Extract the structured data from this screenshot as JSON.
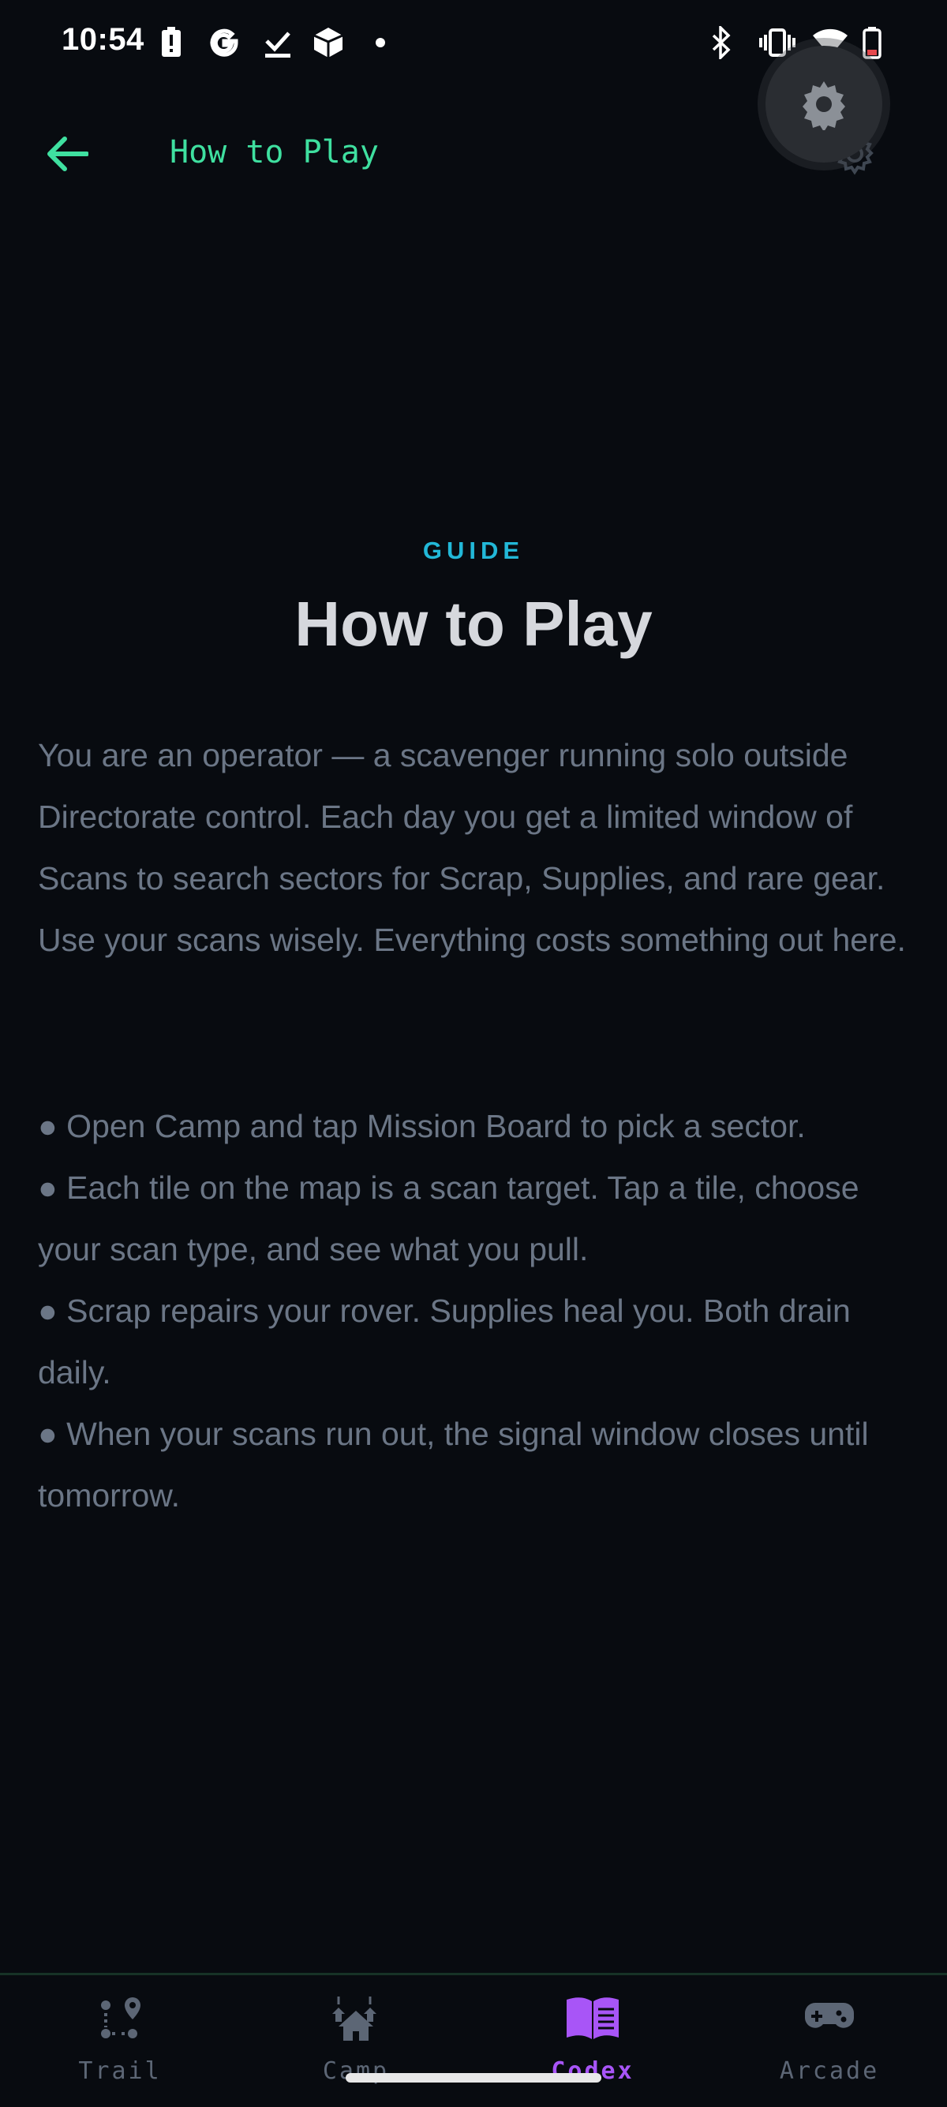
{
  "status_bar": {
    "time": "10:54",
    "icons": [
      "battery-alert-icon",
      "google-icon",
      "download-done-icon",
      "cube-icon",
      "dot-icon",
      "bluetooth-icon",
      "vibrate-icon",
      "wifi-icon",
      "battery-icon"
    ]
  },
  "app_bar": {
    "title": "How to Play",
    "back_icon": "arrow-left-icon",
    "settings_icon": "gear-icon"
  },
  "content": {
    "eyebrow": "GUIDE",
    "title": "How to Play",
    "intro": "You are an operator — a scavenger running solo outside Directorate control. Each day you get a limited window of Scans to search sectors for Scrap, Supplies, and rare gear. Use your scans wisely. Everything costs something out here.",
    "bullet_marker": "●",
    "bullets": [
      "Open Camp and tap Mission Board to pick a sector.",
      "Each tile on the map is a scan target. Tap a tile, choose your scan type, and see what you pull.",
      "Scrap repairs your rover. Supplies heal you. Both drain daily.",
      "When your scans run out, the signal window closes until tomorrow."
    ]
  },
  "bottom_nav": {
    "items": [
      {
        "label": "Trail",
        "icon": "trail-route-icon",
        "active": false
      },
      {
        "label": "Camp",
        "icon": "camp-houses-icon",
        "active": false
      },
      {
        "label": "Codex",
        "icon": "codex-book-icon",
        "active": true
      },
      {
        "label": "Arcade",
        "icon": "gamepad-icon",
        "active": false
      }
    ]
  },
  "colors": {
    "background": "#080b10",
    "accent_green": "#3fe0a0",
    "accent_cyan": "#22b8d8",
    "accent_purple": "#a855f7",
    "body_text": "#6b7686",
    "title_text": "#d6d8dd"
  }
}
